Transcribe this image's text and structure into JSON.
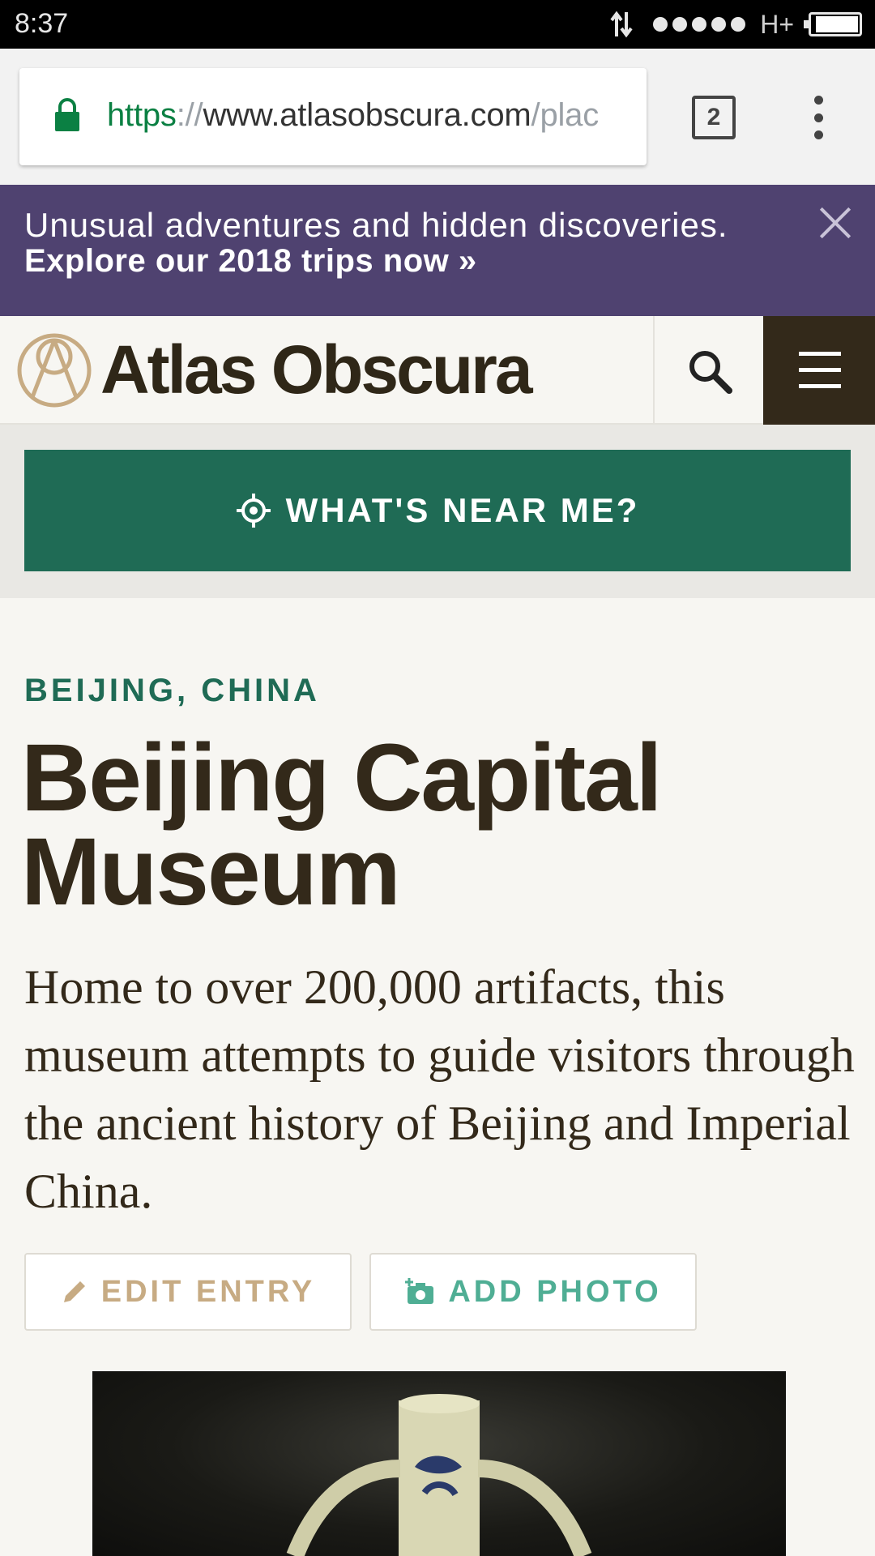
{
  "status": {
    "time": "8:37",
    "network": "H+"
  },
  "browser": {
    "url_scheme": "https",
    "url_sep": "://",
    "url_host": "www.atlasobscura.com",
    "url_path": "/plac",
    "tab_count": "2"
  },
  "promo": {
    "line1": "Unusual adventures and hidden discoveries.",
    "line2": "Explore our 2018 trips now »"
  },
  "header": {
    "logo_text": "Atlas Obscura"
  },
  "near_me": {
    "label": "WHAT'S NEAR ME?"
  },
  "place": {
    "location": "BEIJING, CHINA",
    "title": "Beijing Capital Museum",
    "description": "Home to over 200,000 artifacts, this museum attempts to guide visitors through the ancient history of Beijing and Imperial China."
  },
  "actions": {
    "edit_label": "EDIT ENTRY",
    "photo_label": "ADD PHOTO"
  },
  "colors": {
    "brand_dark": "#33291a",
    "brand_green": "#1f6b55",
    "promo_purple": "#4f4270",
    "edit_tan": "#c7ab83",
    "photo_teal": "#4fae94"
  }
}
